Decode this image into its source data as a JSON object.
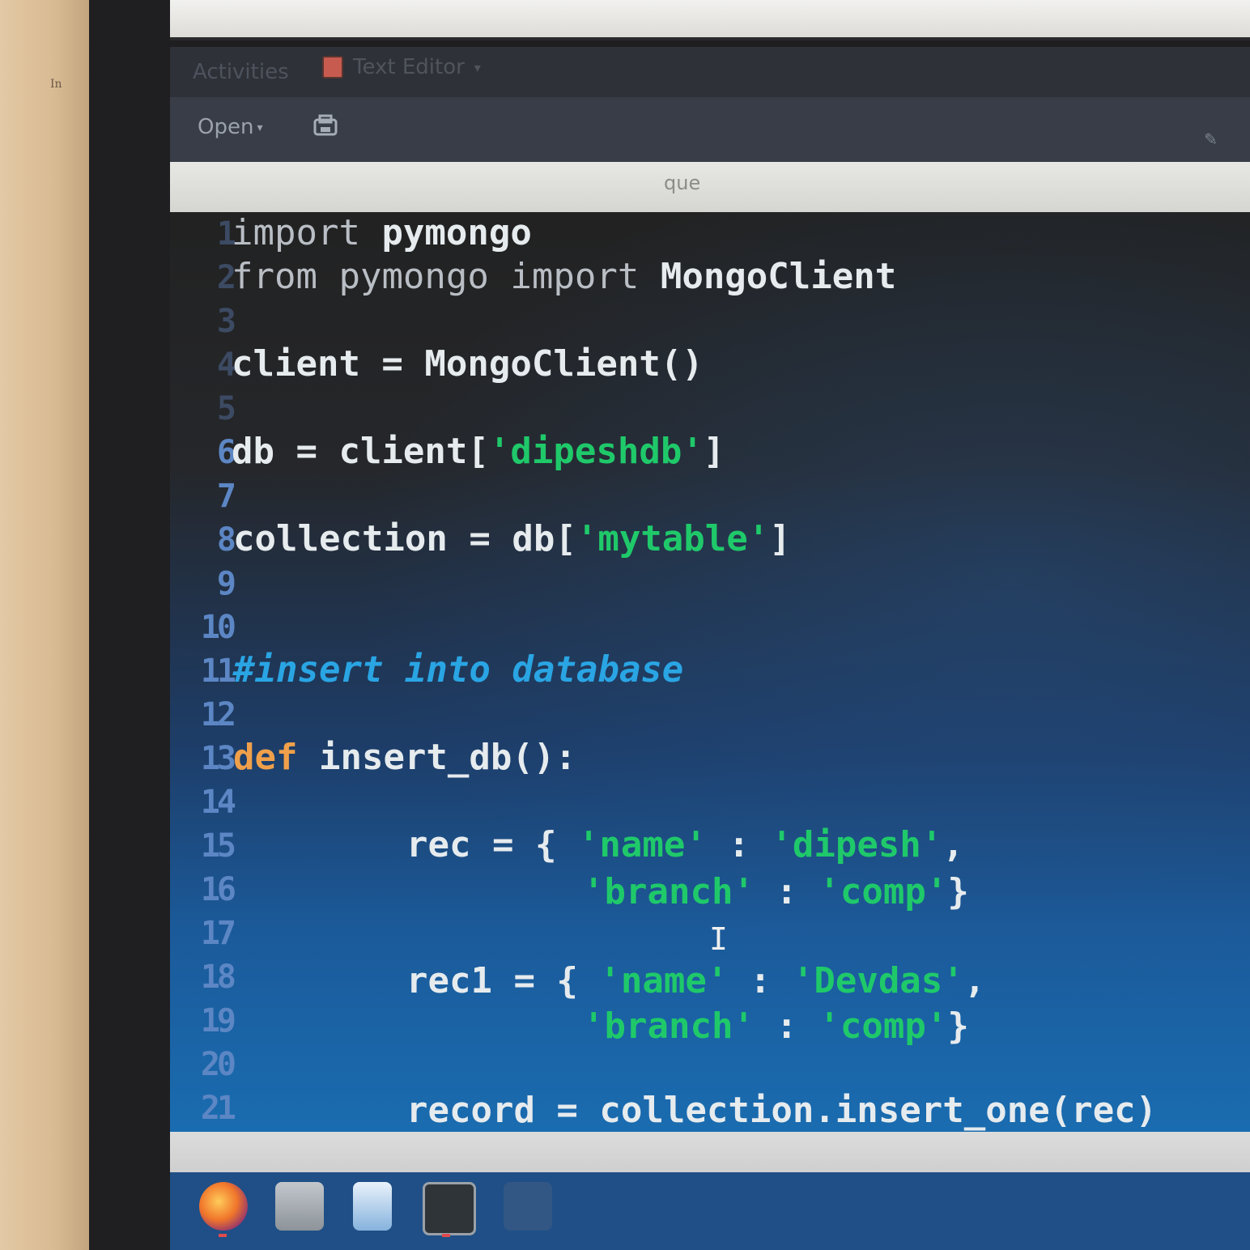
{
  "wall_note": "In",
  "topbar": {
    "activities": "Activities",
    "app_name": "Text Editor",
    "app_caret": "▾"
  },
  "headerbar": {
    "open_label": "Open",
    "open_caret": "▾"
  },
  "tab": {
    "title": "que"
  },
  "editor": {
    "line_numbers": [
      "1",
      "2",
      "3",
      "4",
      "5",
      "6",
      "7",
      "8",
      "9",
      "10",
      "11",
      "12",
      "13",
      "14",
      "15",
      "16",
      "17",
      "18",
      "19",
      "20",
      "21"
    ],
    "lines": {
      "l1": {
        "kw": "import",
        "rest": " pymongo"
      },
      "l2": {
        "kw1": "from",
        "mid": " pymongo ",
        "kw2": "import",
        "rest": " MongoClient"
      },
      "l4": {
        "text": "client = MongoClient()"
      },
      "l6": {
        "pre": "db = client[",
        "str": "'dipeshdb'",
        "post": "]"
      },
      "l8": {
        "pre": "collection = db[",
        "str": "'mytable'",
        "post": "]"
      },
      "l11": {
        "comment": "#insert into database"
      },
      "l13": {
        "def": "def",
        "rest": " insert_db():"
      },
      "l15": {
        "pre": "rec = { ",
        "s1": "'name'",
        "mid": " : ",
        "s2": "'dipesh'",
        "post": ","
      },
      "l16": {
        "s1": "'branch'",
        "mid": " : ",
        "s2": "'comp'",
        "post": "}"
      },
      "l18": {
        "pre": "rec1 = { ",
        "s1": "'name'",
        "mid": " : ",
        "s2": "'Devdas'",
        "post": ","
      },
      "l19": {
        "s1": "'branch'",
        "mid": " : ",
        "s2": "'comp'",
        "post": "}"
      },
      "l21": {
        "text": "record = collection.insert_one(rec)"
      }
    },
    "cursor_glyph": "I"
  },
  "dock": {
    "items": [
      "firefox-icon",
      "files-icon",
      "writer-icon",
      "terminal-icon",
      "app-icon"
    ]
  },
  "colors": {
    "keyword": "#b9bec5",
    "string": "#1fc96a",
    "comment": "#2aa5e4",
    "def": "#f0a04a",
    "line_number": "#5c86c4"
  }
}
